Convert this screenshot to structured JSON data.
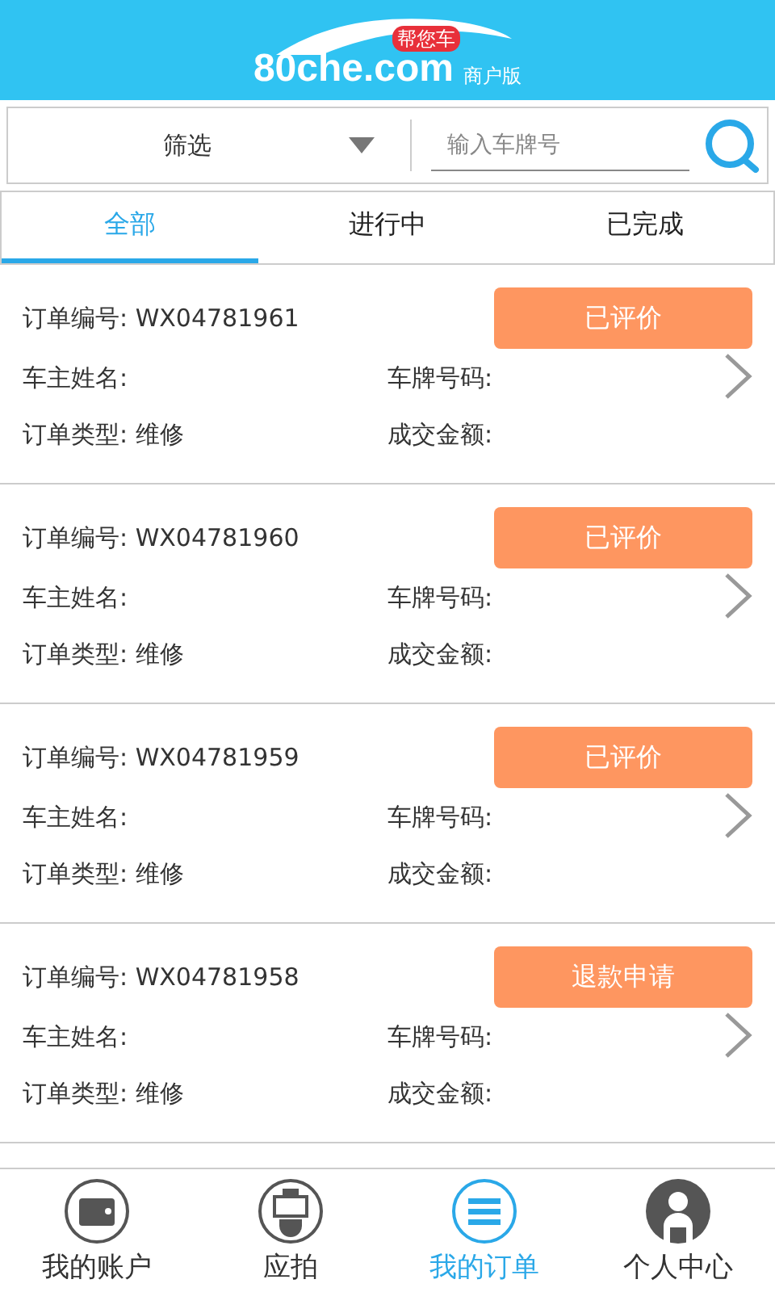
{
  "header": {
    "logo_text": "80che.com",
    "logo_badge": "帮您车",
    "edition": "商户版"
  },
  "filter": {
    "label": "筛选",
    "search_placeholder": "输入车牌号"
  },
  "tabs": [
    {
      "label": "全部",
      "selected": true
    },
    {
      "label": "进行中",
      "selected": false
    },
    {
      "label": "已完成",
      "selected": false
    }
  ],
  "orders": [
    {
      "number_label": "订单编号: WX04781961",
      "action": "已评价",
      "owner_label": "车主姓名:",
      "plate_label": "车牌号码:",
      "type_label": "订单类型: 维修",
      "amount_label": "成交金额:"
    },
    {
      "number_label": "订单编号: WX04781960",
      "action": "已评价",
      "owner_label": "车主姓名:",
      "plate_label": "车牌号码:",
      "type_label": "订单类型: 维修",
      "amount_label": "成交金额:"
    },
    {
      "number_label": "订单编号: WX04781959",
      "action": "已评价",
      "owner_label": "车主姓名:",
      "plate_label": "车牌号码:",
      "type_label": "订单类型: 维修",
      "amount_label": "成交金额:"
    },
    {
      "number_label": "订单编号: WX04781958",
      "action": "退款申请",
      "owner_label": "车主姓名:",
      "plate_label": "车牌号码:",
      "type_label": "订单类型: 维修",
      "amount_label": "成交金额:"
    }
  ],
  "nav": [
    {
      "kind": "wallet",
      "label": "我的账户",
      "selected": false
    },
    {
      "kind": "bid",
      "label": "应拍",
      "selected": false
    },
    {
      "kind": "orders",
      "label": "我的订单",
      "selected": true
    },
    {
      "kind": "person",
      "label": "个人中心",
      "selected": false
    }
  ]
}
